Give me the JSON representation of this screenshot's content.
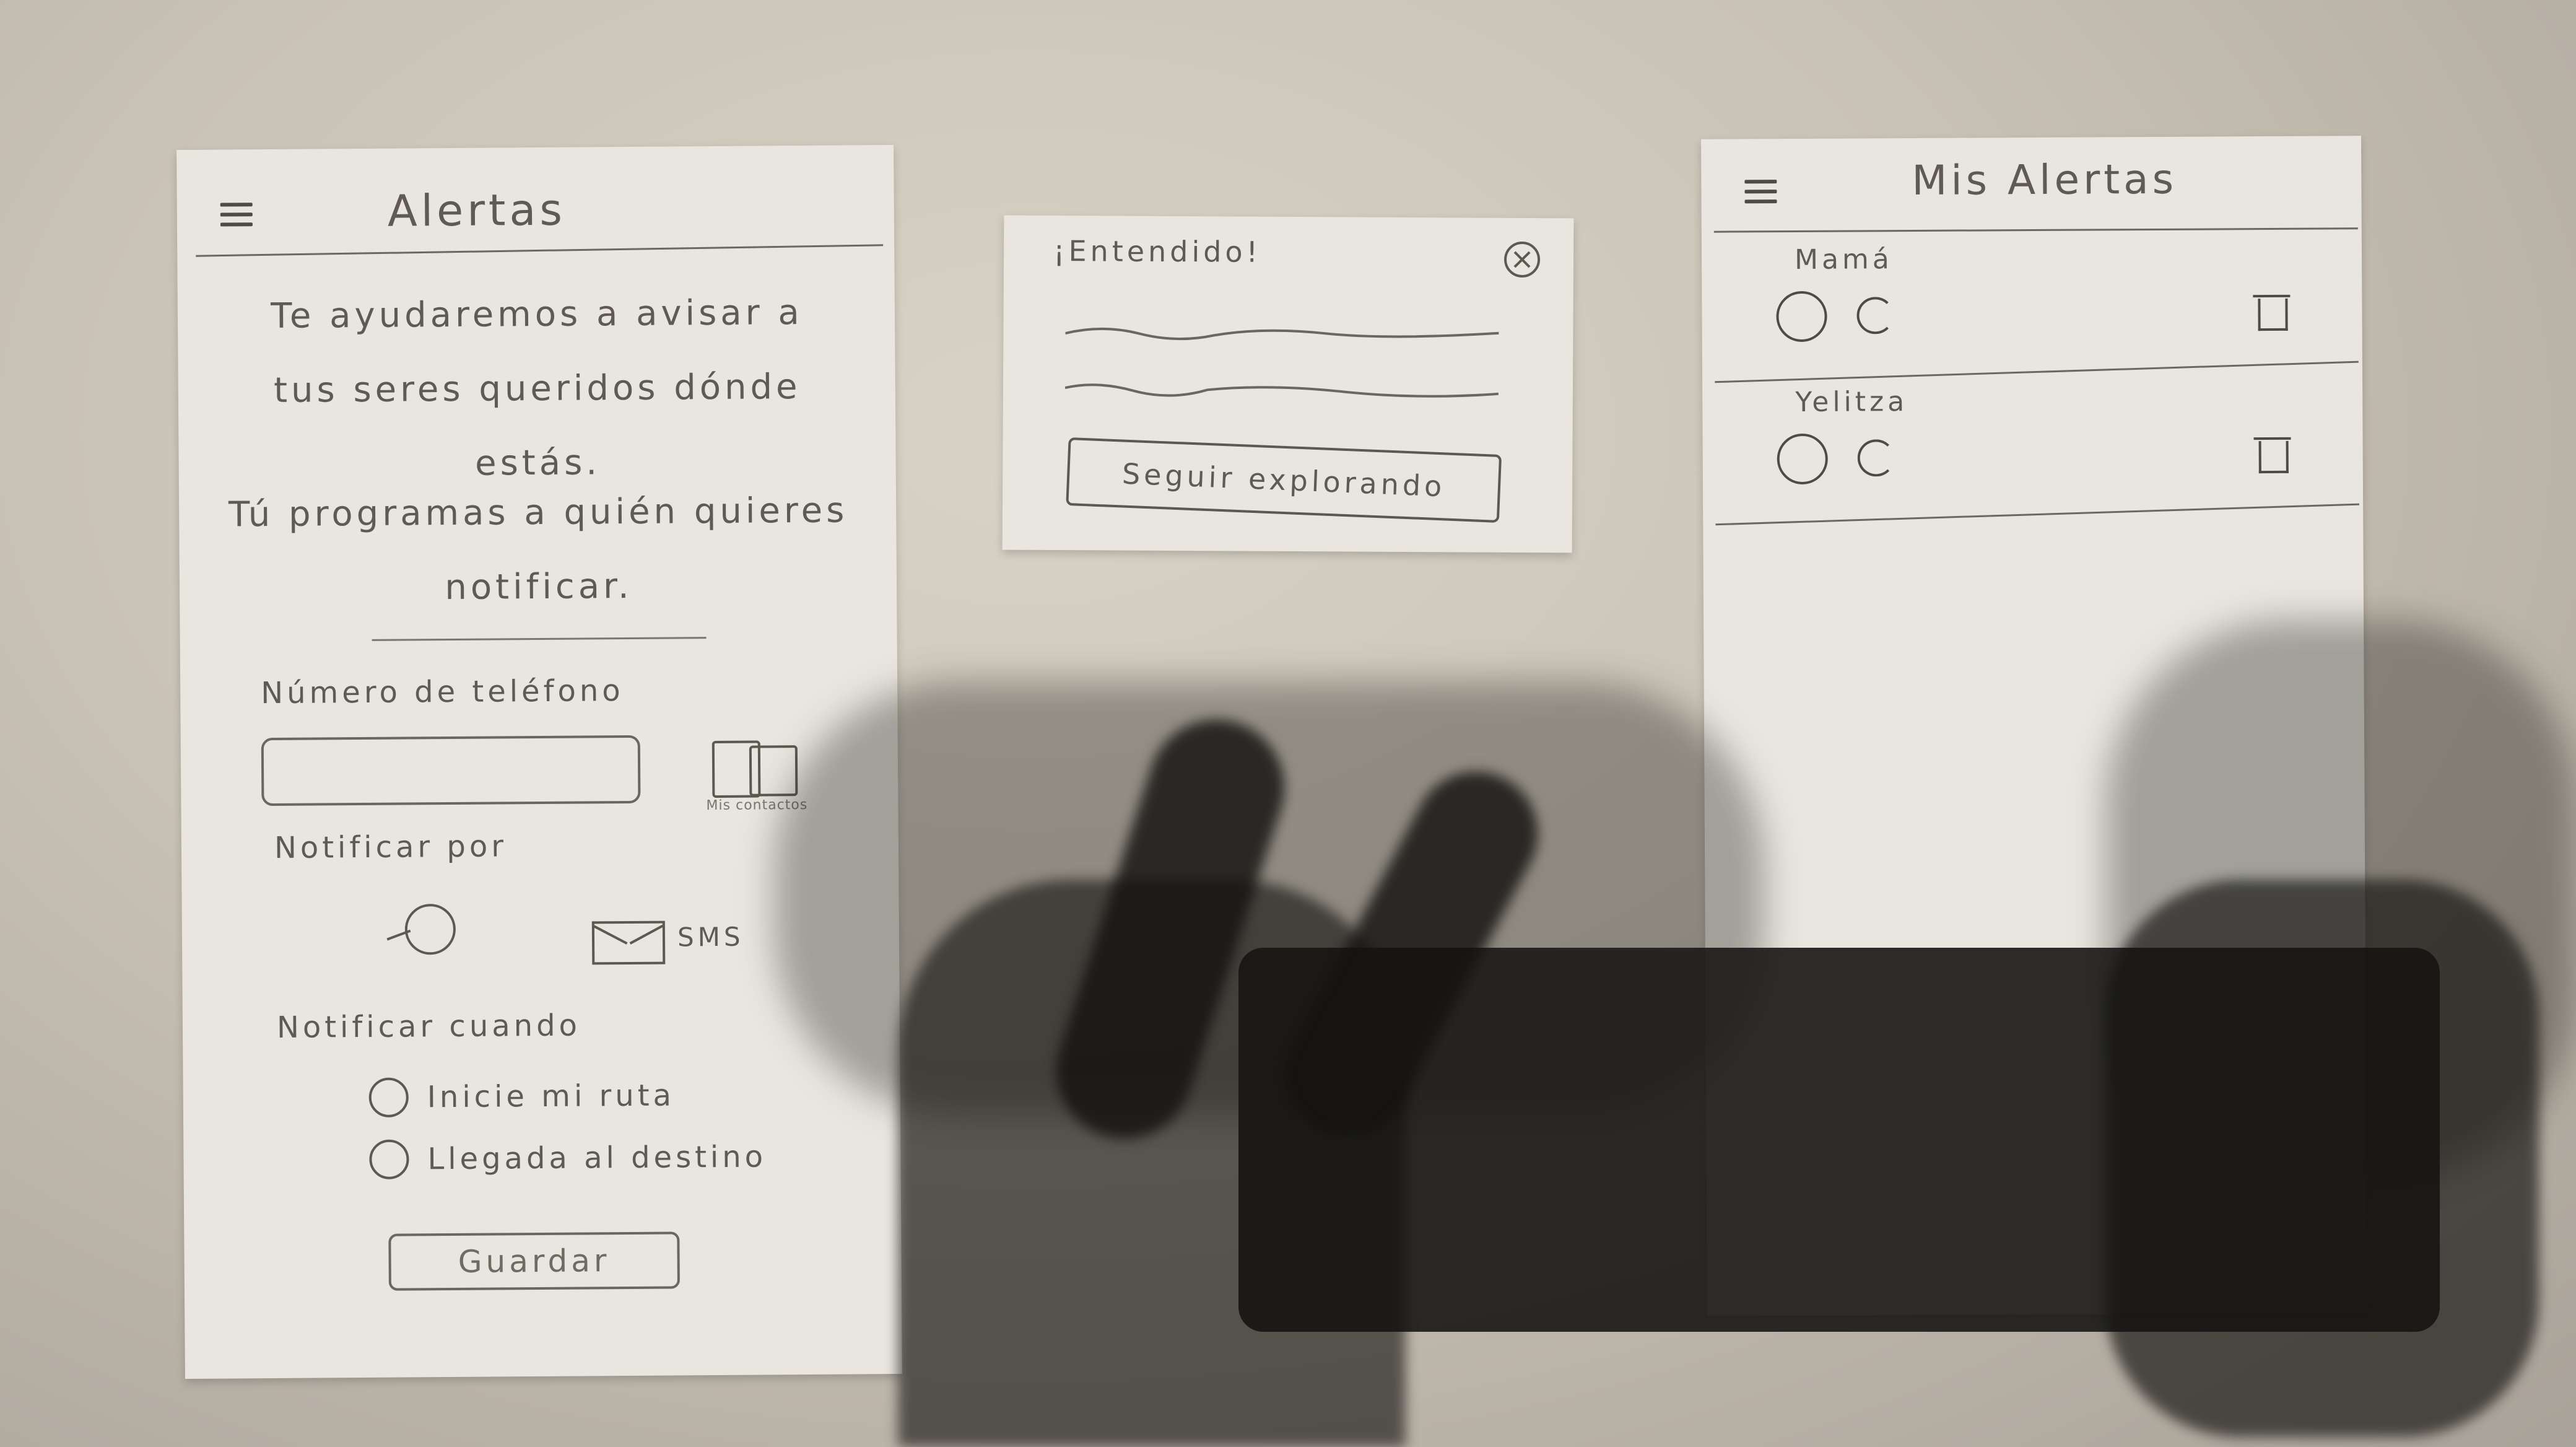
{
  "screen_alertas": {
    "title": "Alertas",
    "intro_lines": [
      "Te ayudaremos a avisar a",
      "tus seres queridos dónde",
      "estás."
    ],
    "intro2_lines": [
      "Tú programas a quién quieres",
      "notificar."
    ],
    "phone_label": "Número de teléfono",
    "phone_value": "",
    "contacts_caption": "Mis contactos",
    "notify_by_label": "Notificar por",
    "sms_label": "SMS",
    "notify_when_label": "Notificar cuando",
    "options": [
      "Inicie mi ruta",
      "Llegada al destino"
    ],
    "save_label": "Guardar"
  },
  "screen_dialog": {
    "title": "¡Entendido!",
    "button_label": "Seguir explorando"
  },
  "screen_mis_alertas": {
    "title": "Mis Alertas",
    "contacts": [
      {
        "name": "Mamá"
      },
      {
        "name": "Yelitza"
      }
    ]
  },
  "icons": {
    "menu": "menu-icon",
    "contacts": "contacts-book-icon",
    "whatsapp": "whatsapp-icon",
    "sms": "envelope-icon",
    "close": "close-icon",
    "trash": "trash-icon"
  }
}
